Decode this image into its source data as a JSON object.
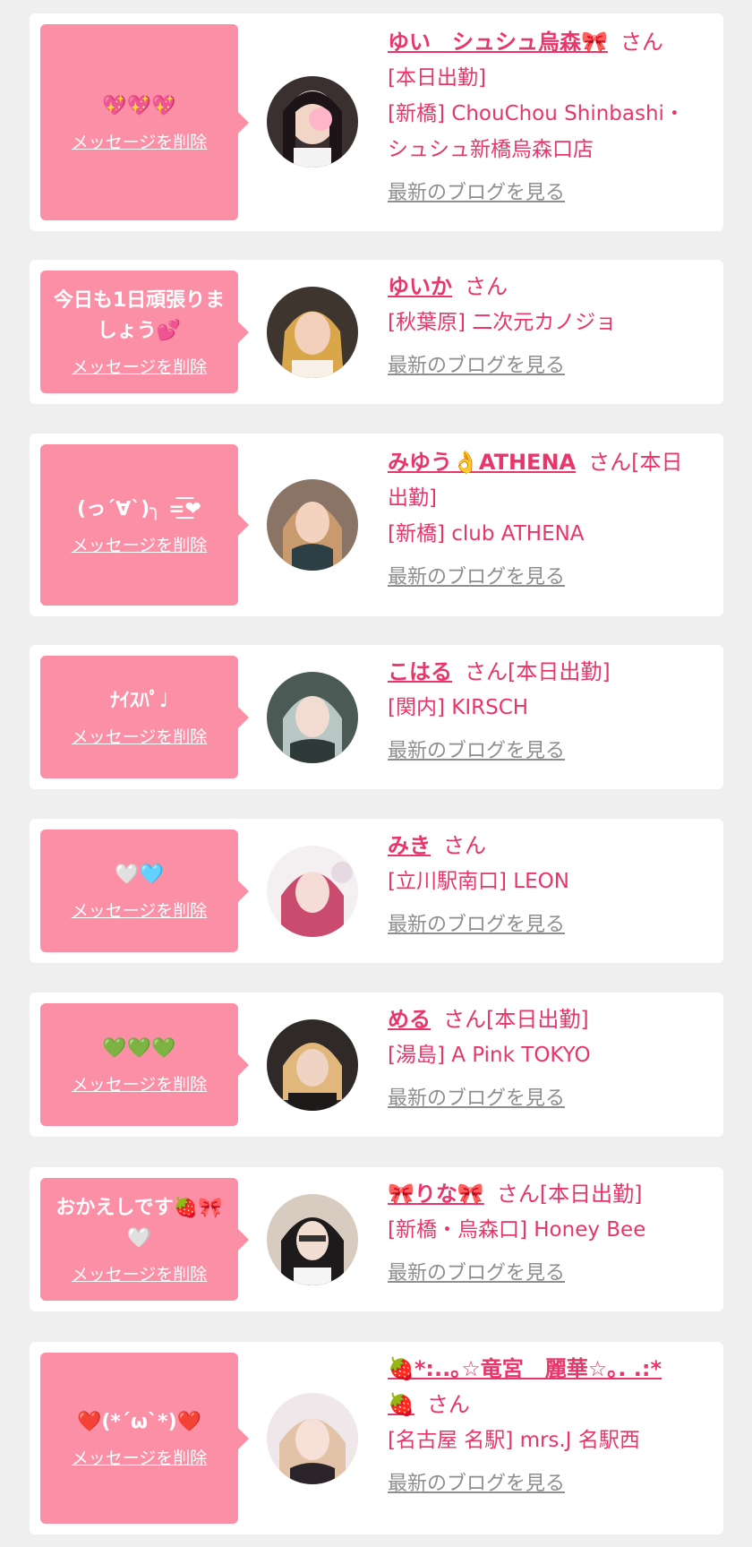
{
  "colors": {
    "page_bg": "#efefef",
    "card_bg": "#ffffff",
    "bubble_bg": "#fb8fa6",
    "accent": "#e8356a",
    "link_gray": "#8e8e8e"
  },
  "delete_label": "メッセージを削除",
  "blog_label": "最新のブログを見る",
  "honorific": "さん",
  "entries": [
    {
      "message": "💖💖💖",
      "name": "ゆい　シュシュ烏森🎀",
      "status": "[本日出勤]",
      "shop_lines": [
        "[新橋] ChouChou Shinbashi・",
        "シュシュ新橋烏森口店"
      ]
    },
    {
      "message": "今日も1日頑張りましょう💕",
      "name": "ゆいか",
      "status": "",
      "shop_lines": [
        "[秋葉原] 二次元カノジョ"
      ]
    },
    {
      "message": "(っ´∀`)╮ =͟͟͞͞❤",
      "name": "みゆう👌ATHENA",
      "status": "[本日",
      "status2": "出勤]",
      "shop_lines": [
        "[新橋] club ATHENA"
      ]
    },
    {
      "message": "ﾅｲｽﾊﾟ♩",
      "name": "こはる",
      "status": "[本日出勤]",
      "shop_lines": [
        "[関内] KIRSCH"
      ]
    },
    {
      "message": "🤍🩵",
      "name": "みき",
      "status": "",
      "shop_lines": [
        "[立川駅南口] LEON"
      ]
    },
    {
      "message": "💚💚💚",
      "name": "める",
      "status": "[本日出勤]",
      "shop_lines": [
        "[湯島] A Pink TOKYO"
      ]
    },
    {
      "message": "おかえしです🍓🎀🤍",
      "name": "🎀りな🎀",
      "status": "[本日出勤]",
      "shop_lines": [
        "[新橋・烏森口] Honey Bee"
      ]
    },
    {
      "message": "❤️(*´ω`*)❤️",
      "name": "🍓*:..｡☆竜宮　麗華☆｡. .:*",
      "name2": "🍓",
      "status": "",
      "shop_lines": [
        "[名古屋 名駅] mrs.J 名駅西"
      ]
    }
  ]
}
